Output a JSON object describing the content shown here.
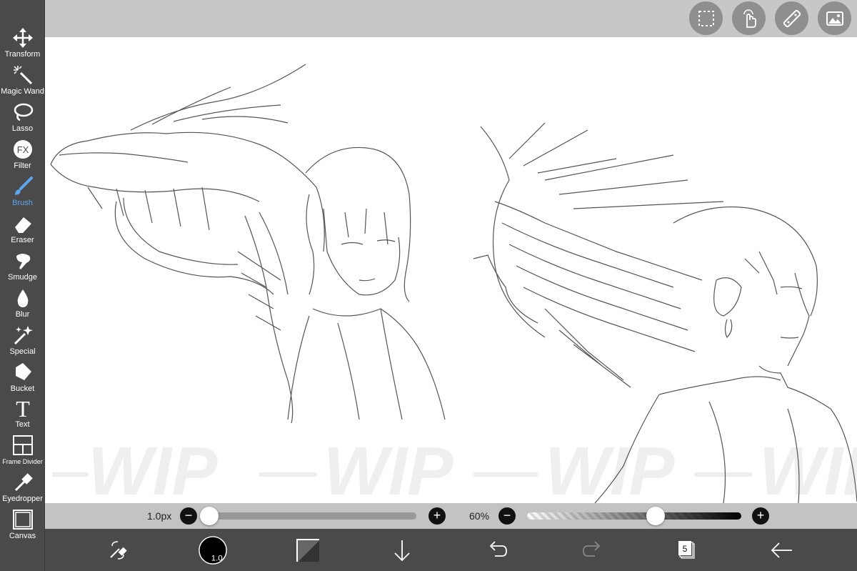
{
  "sidebar": {
    "tools": [
      {
        "label": "Transform",
        "icon": "move-arrows-icon"
      },
      {
        "label": "Magic Wand",
        "icon": "magic-wand-icon"
      },
      {
        "label": "Lasso",
        "icon": "lasso-icon"
      },
      {
        "label": "Filter",
        "icon": "fx-icon"
      },
      {
        "label": "Brush",
        "icon": "brush-icon"
      },
      {
        "label": "Eraser",
        "icon": "eraser-icon"
      },
      {
        "label": "Smudge",
        "icon": "smudge-icon"
      },
      {
        "label": "Blur",
        "icon": "droplet-icon"
      },
      {
        "label": "Special",
        "icon": "sparkle-icon"
      },
      {
        "label": "Bucket",
        "icon": "bucket-icon"
      },
      {
        "label": "Text",
        "icon": "text-icon"
      },
      {
        "label": "Frame Divider",
        "icon": "frame-divider-icon"
      },
      {
        "label": "Eyedropper",
        "icon": "eyedropper-icon"
      },
      {
        "label": "Canvas",
        "icon": "canvas-icon"
      }
    ],
    "active": "Brush",
    "active_color": "#5aa7f0",
    "fx_text": "FX",
    "text_glyph": "T"
  },
  "topbar": {
    "buttons": [
      "selection-icon",
      "touch-gesture-icon",
      "ruler-icon",
      "image-icon"
    ]
  },
  "canvas": {
    "watermark": "WIP"
  },
  "sliders": {
    "size_label": "1.0px",
    "size_value": 0.0,
    "opacity_label": "60%",
    "opacity_value": 0.6,
    "minus": "−",
    "plus": "+"
  },
  "bottombar": {
    "brush_size": "1.0",
    "layer_count": "5",
    "icons": [
      "swap-tools-icon",
      "brush-size-icon",
      "color-swatch-icon",
      "import-down-arrow-icon",
      "undo-icon",
      "redo-icon",
      "layers-icon",
      "back-arrow-icon"
    ]
  }
}
